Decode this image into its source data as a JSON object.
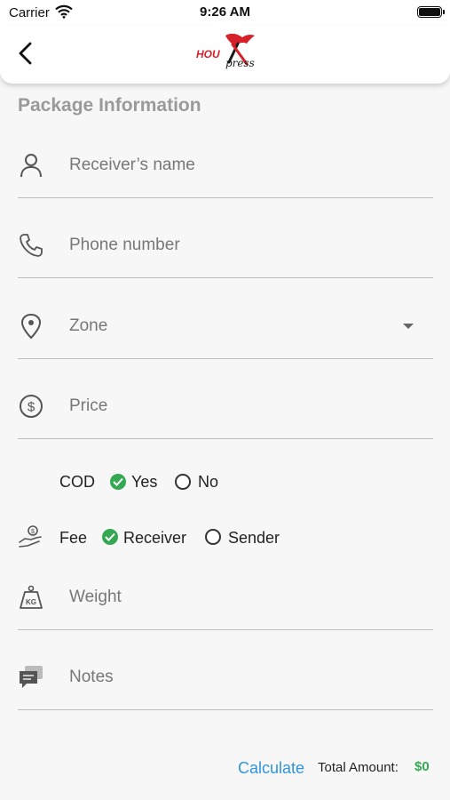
{
  "status_bar": {
    "carrier": "Carrier",
    "time": "9:26 AM"
  },
  "header": {
    "logo_part1": "HOU",
    "logo_part2": "press",
    "back_icon": "chevron-left-icon"
  },
  "form": {
    "section_title": "Package Information",
    "receiver_name": {
      "placeholder": "Receiver’s name",
      "icon": "user-icon"
    },
    "phone": {
      "placeholder": "Phone number",
      "icon": "phone-icon"
    },
    "zone": {
      "placeholder": "Zone",
      "icon": "location-pin-icon"
    },
    "price": {
      "placeholder": "Price",
      "icon": "dollar-circle-icon"
    },
    "cod": {
      "label": "COD",
      "options": [
        "Yes",
        "No"
      ],
      "selected": "Yes"
    },
    "fee": {
      "label": "Fee",
      "options": [
        "Receiver",
        "Sender"
      ],
      "selected": "Receiver",
      "icon": "money-hand-icon"
    },
    "weight": {
      "placeholder": "Weight",
      "icon": "kg-weight-icon"
    },
    "notes": {
      "placeholder": "Notes",
      "icon": "chat-bubble-icon"
    }
  },
  "footer": {
    "calculate_label": "Calculate",
    "total_label": "Total Amount:",
    "total_value": "$0"
  },
  "colors": {
    "accent_blue": "#2f95dc",
    "success_green": "#34a853",
    "brand_red": "#d6212b"
  }
}
